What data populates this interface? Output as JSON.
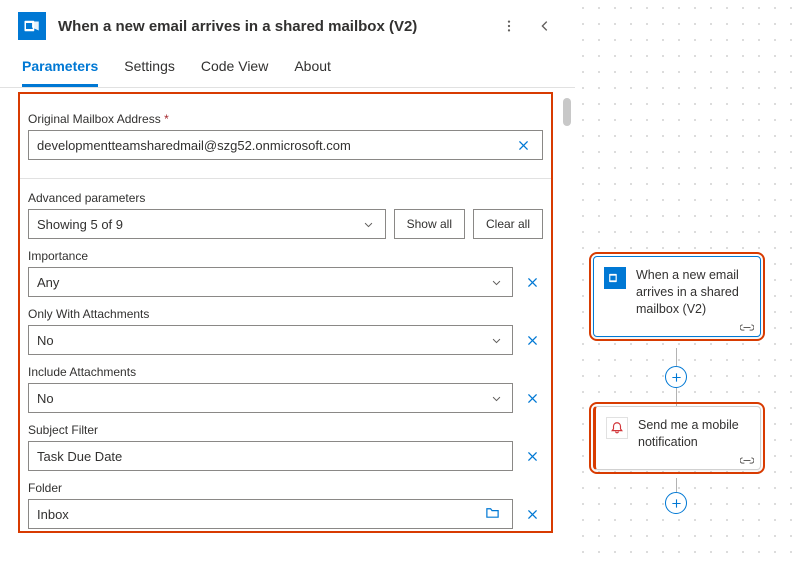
{
  "header": {
    "title": "When a new email arrives in a shared mailbox (V2)"
  },
  "tabs": [
    "Parameters",
    "Settings",
    "Code View",
    "About"
  ],
  "form": {
    "mailbox": {
      "label": "Original Mailbox Address",
      "value": "developmentteamsharedmail@szg52.onmicrosoft.com"
    },
    "adv_label": "Advanced parameters",
    "adv_summary": "Showing 5 of 9",
    "show_all": "Show all",
    "clear_all": "Clear all",
    "importance": {
      "label": "Importance",
      "value": "Any"
    },
    "only_attach": {
      "label": "Only With Attachments",
      "value": "No"
    },
    "include_attach": {
      "label": "Include Attachments",
      "value": "No"
    },
    "subject": {
      "label": "Subject Filter",
      "value": "Task Due Date"
    },
    "folder": {
      "label": "Folder",
      "value": "Inbox"
    }
  },
  "canvas": {
    "card1": "When a new email arrives in a shared mailbox (V2)",
    "card2": "Send me a mobile notification"
  }
}
